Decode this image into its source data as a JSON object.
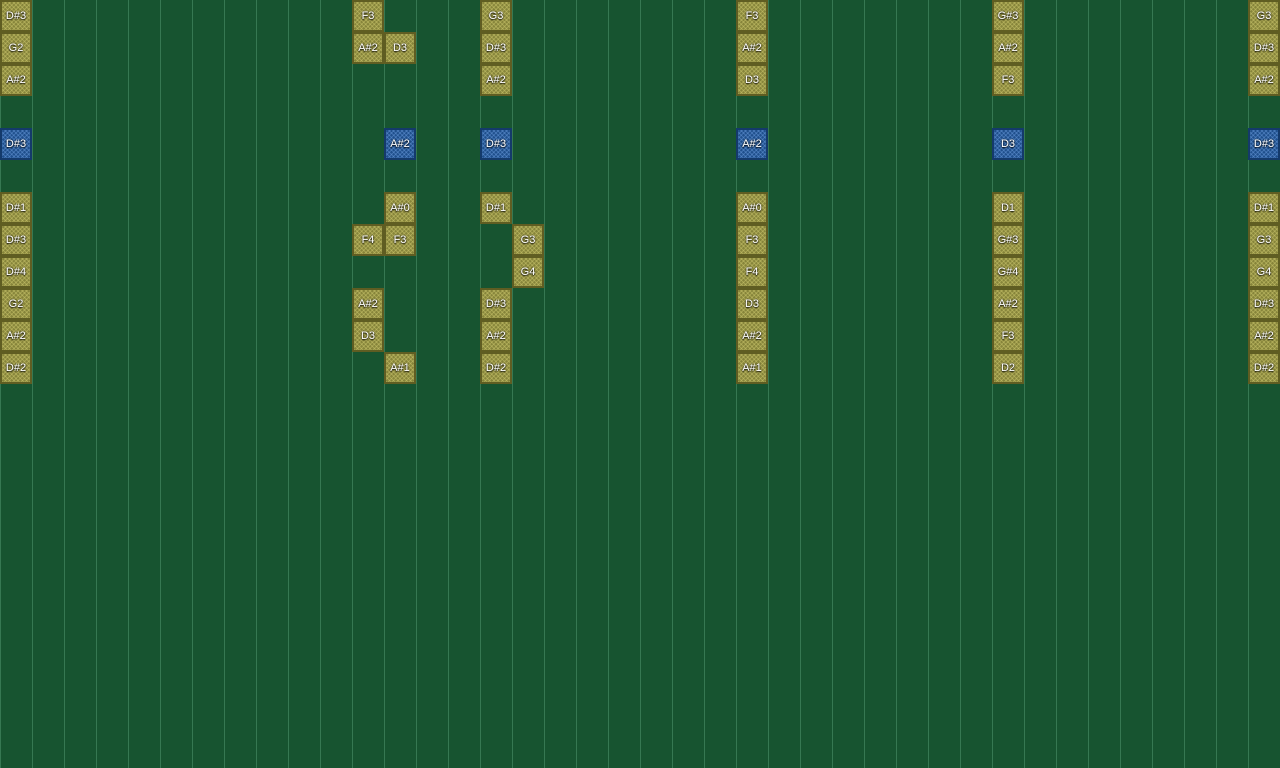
{
  "colors": {
    "background": "#175430",
    "gridline": "#50966e",
    "note_olive": "#86843a",
    "note_blue": "#1f4f8c",
    "note_text": "#ffffff"
  },
  "notes": [
    {
      "col": 0,
      "row": 0,
      "label": "D#3",
      "kind": "olive"
    },
    {
      "col": 0,
      "row": 1,
      "label": "G2",
      "kind": "olive"
    },
    {
      "col": 0,
      "row": 2,
      "label": "A#2",
      "kind": "olive"
    },
    {
      "col": 0,
      "row": 4,
      "label": "D#3",
      "kind": "blue"
    },
    {
      "col": 0,
      "row": 6,
      "label": "D#1",
      "kind": "olive"
    },
    {
      "col": 0,
      "row": 7,
      "label": "D#3",
      "kind": "olive"
    },
    {
      "col": 0,
      "row": 8,
      "label": "D#4",
      "kind": "olive"
    },
    {
      "col": 0,
      "row": 9,
      "label": "G2",
      "kind": "olive"
    },
    {
      "col": 0,
      "row": 10,
      "label": "A#2",
      "kind": "olive"
    },
    {
      "col": 0,
      "row": 11,
      "label": "D#2",
      "kind": "olive"
    },
    {
      "col": 11,
      "row": 0,
      "label": "F3",
      "kind": "olive"
    },
    {
      "col": 11,
      "row": 1,
      "label": "A#2",
      "kind": "olive"
    },
    {
      "col": 11,
      "row": 7,
      "label": "F4",
      "kind": "olive"
    },
    {
      "col": 11,
      "row": 9,
      "label": "A#2",
      "kind": "olive"
    },
    {
      "col": 11,
      "row": 10,
      "label": "D3",
      "kind": "olive"
    },
    {
      "col": 12,
      "row": 1,
      "label": "D3",
      "kind": "olive"
    },
    {
      "col": 12,
      "row": 4,
      "label": "A#2",
      "kind": "blue"
    },
    {
      "col": 12,
      "row": 6,
      "label": "A#0",
      "kind": "olive"
    },
    {
      "col": 12,
      "row": 7,
      "label": "F3",
      "kind": "olive"
    },
    {
      "col": 12,
      "row": 11,
      "label": "A#1",
      "kind": "olive"
    },
    {
      "col": 15,
      "row": 0,
      "label": "G3",
      "kind": "olive"
    },
    {
      "col": 15,
      "row": 1,
      "label": "D#3",
      "kind": "olive"
    },
    {
      "col": 15,
      "row": 2,
      "label": "A#2",
      "kind": "olive"
    },
    {
      "col": 15,
      "row": 4,
      "label": "D#3",
      "kind": "blue"
    },
    {
      "col": 15,
      "row": 6,
      "label": "D#1",
      "kind": "olive"
    },
    {
      "col": 15,
      "row": 9,
      "label": "D#3",
      "kind": "olive"
    },
    {
      "col": 15,
      "row": 10,
      "label": "A#2",
      "kind": "olive"
    },
    {
      "col": 15,
      "row": 11,
      "label": "D#2",
      "kind": "olive"
    },
    {
      "col": 16,
      "row": 7,
      "label": "G3",
      "kind": "olive"
    },
    {
      "col": 16,
      "row": 8,
      "label": "G4",
      "kind": "olive"
    },
    {
      "col": 23,
      "row": 0,
      "label": "F3",
      "kind": "olive"
    },
    {
      "col": 23,
      "row": 1,
      "label": "A#2",
      "kind": "olive"
    },
    {
      "col": 23,
      "row": 2,
      "label": "D3",
      "kind": "olive"
    },
    {
      "col": 23,
      "row": 4,
      "label": "A#2",
      "kind": "blue"
    },
    {
      "col": 23,
      "row": 6,
      "label": "A#0",
      "kind": "olive"
    },
    {
      "col": 23,
      "row": 7,
      "label": "F3",
      "kind": "olive"
    },
    {
      "col": 23,
      "row": 8,
      "label": "F4",
      "kind": "olive"
    },
    {
      "col": 23,
      "row": 9,
      "label": "D3",
      "kind": "olive"
    },
    {
      "col": 23,
      "row": 10,
      "label": "A#2",
      "kind": "olive"
    },
    {
      "col": 23,
      "row": 11,
      "label": "A#1",
      "kind": "olive"
    },
    {
      "col": 31,
      "row": 0,
      "label": "G#3",
      "kind": "olive"
    },
    {
      "col": 31,
      "row": 1,
      "label": "A#2",
      "kind": "olive"
    },
    {
      "col": 31,
      "row": 2,
      "label": "F3",
      "kind": "olive"
    },
    {
      "col": 31,
      "row": 4,
      "label": "D3",
      "kind": "blue"
    },
    {
      "col": 31,
      "row": 6,
      "label": "D1",
      "kind": "olive"
    },
    {
      "col": 31,
      "row": 7,
      "label": "G#3",
      "kind": "olive"
    },
    {
      "col": 31,
      "row": 8,
      "label": "G#4",
      "kind": "olive"
    },
    {
      "col": 31,
      "row": 9,
      "label": "A#2",
      "kind": "olive"
    },
    {
      "col": 31,
      "row": 10,
      "label": "F3",
      "kind": "olive"
    },
    {
      "col": 31,
      "row": 11,
      "label": "D2",
      "kind": "olive"
    },
    {
      "col": 39,
      "row": 0,
      "label": "G3",
      "kind": "olive"
    },
    {
      "col": 39,
      "row": 1,
      "label": "D#3",
      "kind": "olive"
    },
    {
      "col": 39,
      "row": 2,
      "label": "A#2",
      "kind": "olive"
    },
    {
      "col": 39,
      "row": 4,
      "label": "D#3",
      "kind": "blue"
    },
    {
      "col": 39,
      "row": 6,
      "label": "D#1",
      "kind": "olive"
    },
    {
      "col": 39,
      "row": 7,
      "label": "G3",
      "kind": "olive"
    },
    {
      "col": 39,
      "row": 8,
      "label": "G4",
      "kind": "olive"
    },
    {
      "col": 39,
      "row": 9,
      "label": "D#3",
      "kind": "olive"
    },
    {
      "col": 39,
      "row": 10,
      "label": "A#2",
      "kind": "olive"
    },
    {
      "col": 39,
      "row": 11,
      "label": "D#2",
      "kind": "olive"
    }
  ]
}
